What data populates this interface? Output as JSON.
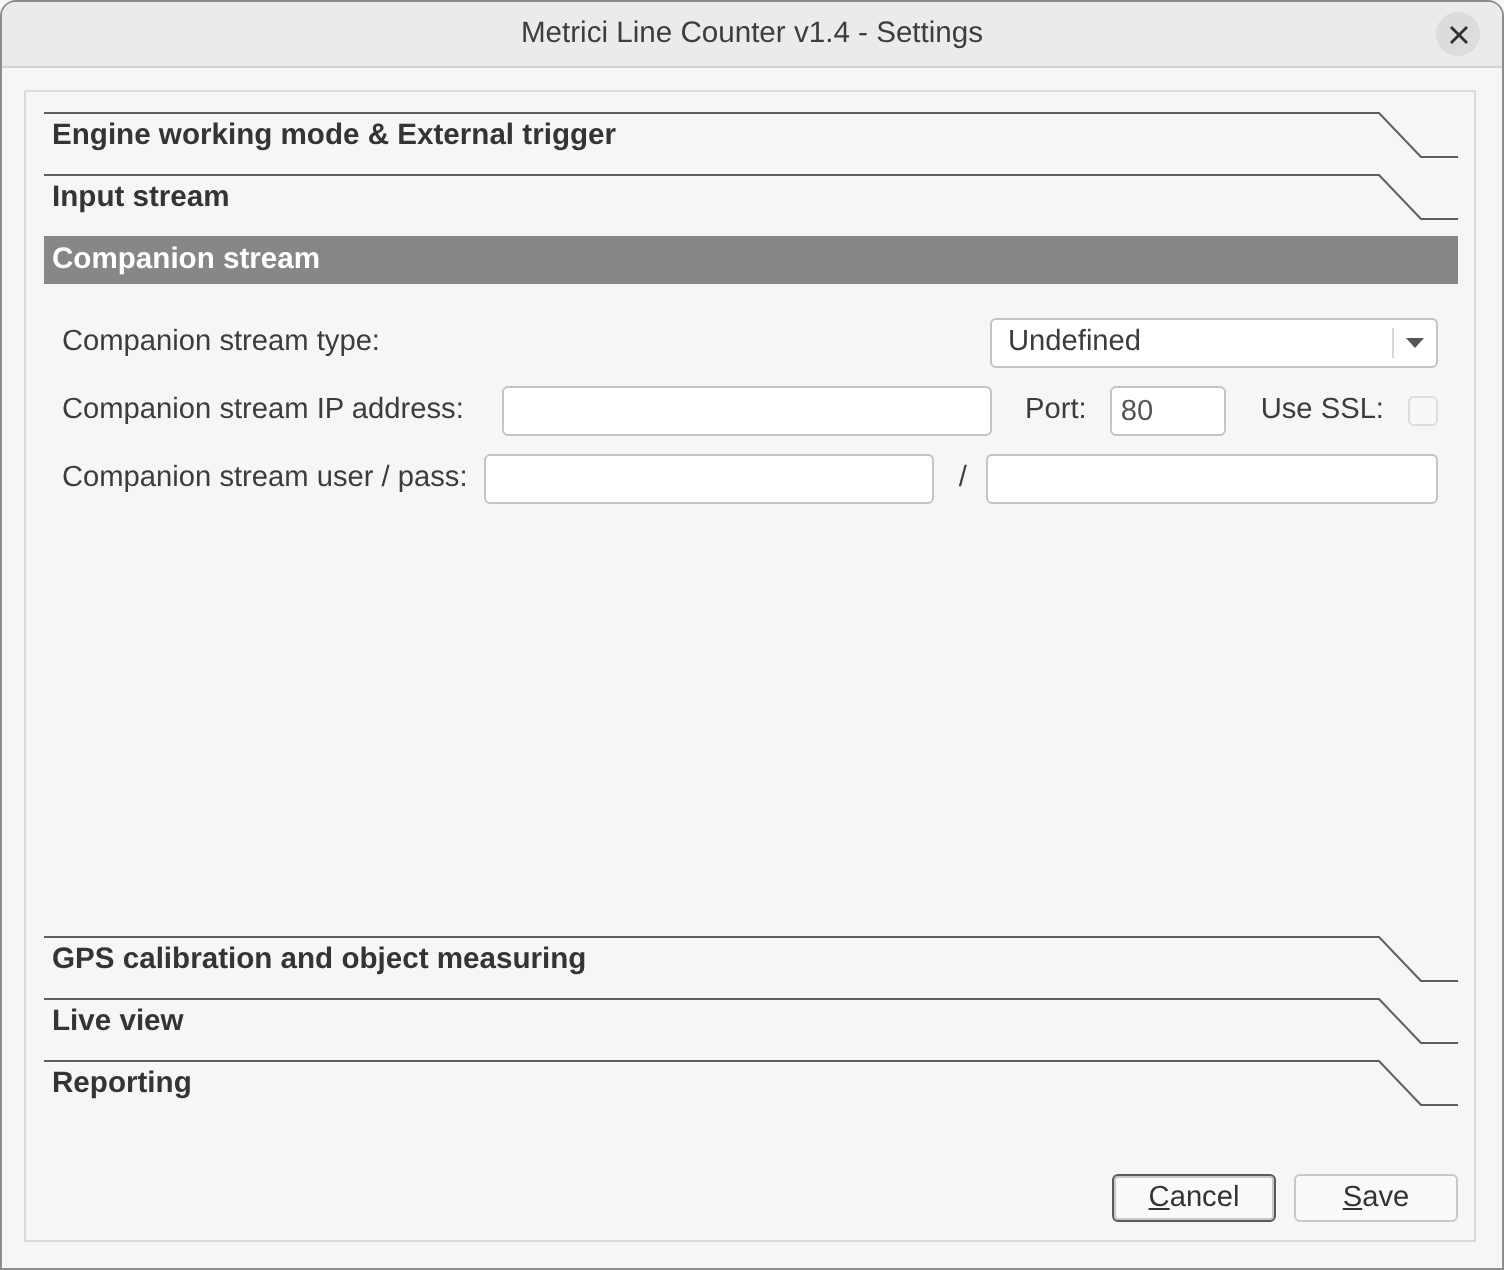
{
  "window": {
    "title": "Metrici Line Counter v1.4 - Settings"
  },
  "sections": [
    {
      "label": "Engine working mode & External trigger",
      "selected": false
    },
    {
      "label": "Input stream",
      "selected": false
    },
    {
      "label": "Companion stream",
      "selected": true,
      "rows": [
        {
          "items": [
            {
              "kind": "label",
              "text": "Companion stream type:"
            },
            {
              "kind": "select",
              "value": "Undefined"
            }
          ]
        },
        {
          "items": [
            {
              "kind": "label",
              "text": "Companion stream IP address:"
            },
            {
              "kind": "input"
            },
            {
              "kind": "label",
              "text": "Port:"
            },
            {
              "kind": "input",
              "value": "80"
            },
            {
              "kind": "label",
              "text": "Use SSL:"
            },
            {
              "kind": "checkbox",
              "checked": false,
              "disabled": true
            }
          ]
        },
        {
          "items": [
            {
              "kind": "label",
              "text": "Companion stream user / pass:"
            },
            {
              "kind": "input"
            },
            {
              "kind": "label",
              "text": "/"
            },
            {
              "kind": "input"
            }
          ]
        }
      ]
    },
    {
      "label": "GPS calibration and object measuring",
      "selected": false
    },
    {
      "label": "Live view",
      "selected": false
    },
    {
      "label": "Reporting",
      "selected": false
    }
  ],
  "buttons": [
    {
      "label": "Cancel",
      "mnemonic": true,
      "focused": true
    },
    {
      "label": "Save",
      "mnemonic": true,
      "focused": false
    }
  ]
}
